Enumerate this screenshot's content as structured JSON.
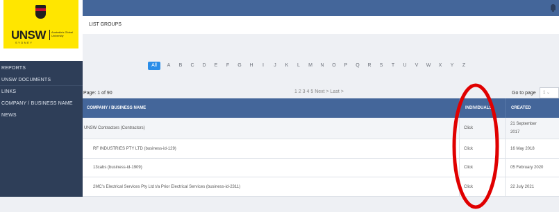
{
  "logo": {
    "word": "UNSW",
    "sub": "SYDNEY",
    "tagline": "Australia's Global University"
  },
  "sidebar": {
    "items": [
      {
        "label": "REPORTS"
      },
      {
        "label": "UNSW DOCUMENTS"
      },
      {
        "label": "LINKS"
      },
      {
        "label": "COMPANY / BUSINESS NAME"
      },
      {
        "label": "NEWS"
      }
    ]
  },
  "header": {
    "title": "LIST GROUPS"
  },
  "alphabet": [
    "All",
    "A",
    "B",
    "C",
    "D",
    "E",
    "F",
    "G",
    "H",
    "I",
    "J",
    "K",
    "L",
    "M",
    "N",
    "O",
    "P",
    "Q",
    "R",
    "S",
    "T",
    "U",
    "V",
    "W",
    "X",
    "Y",
    "Z"
  ],
  "pagination": {
    "page_info": "Page: 1 of 90",
    "pager": "1 2 3 4 5 Next > Last >",
    "goto_label": "Go to page",
    "goto_value": "1"
  },
  "table": {
    "columns": [
      "COMPANY / BUSINESS NAME",
      "INDIVIDUALS",
      "CREATED"
    ],
    "rows": [
      {
        "name": "UNSW Contractors (Contractors)",
        "individuals": "Click",
        "created_1": "21 September",
        "created_2": "2017"
      },
      {
        "name": "RF INDUSTRIES PTY LTD (business-id-129)",
        "individuals": "Click",
        "created_1": "16 May 2018",
        "created_2": ""
      },
      {
        "name": "13cabs (business-id-1909)",
        "individuals": "Click",
        "created_1": "05 February 2020",
        "created_2": ""
      },
      {
        "name": "2MC's Electrical Services Pty Ltd t/a Prior Electrical Services (business-id-2311)",
        "individuals": "Click",
        "created_1": "22 July 2021",
        "created_2": ""
      }
    ]
  },
  "colors": {
    "topbar": "#44669a",
    "sidebar": "#2e3e58",
    "logo": "#ffe600",
    "accent": "#2a8de8",
    "annotation": "#e00000"
  },
  "icons": [
    "bell-icon",
    "user-avatar-icon",
    "chevron-down-icon"
  ]
}
